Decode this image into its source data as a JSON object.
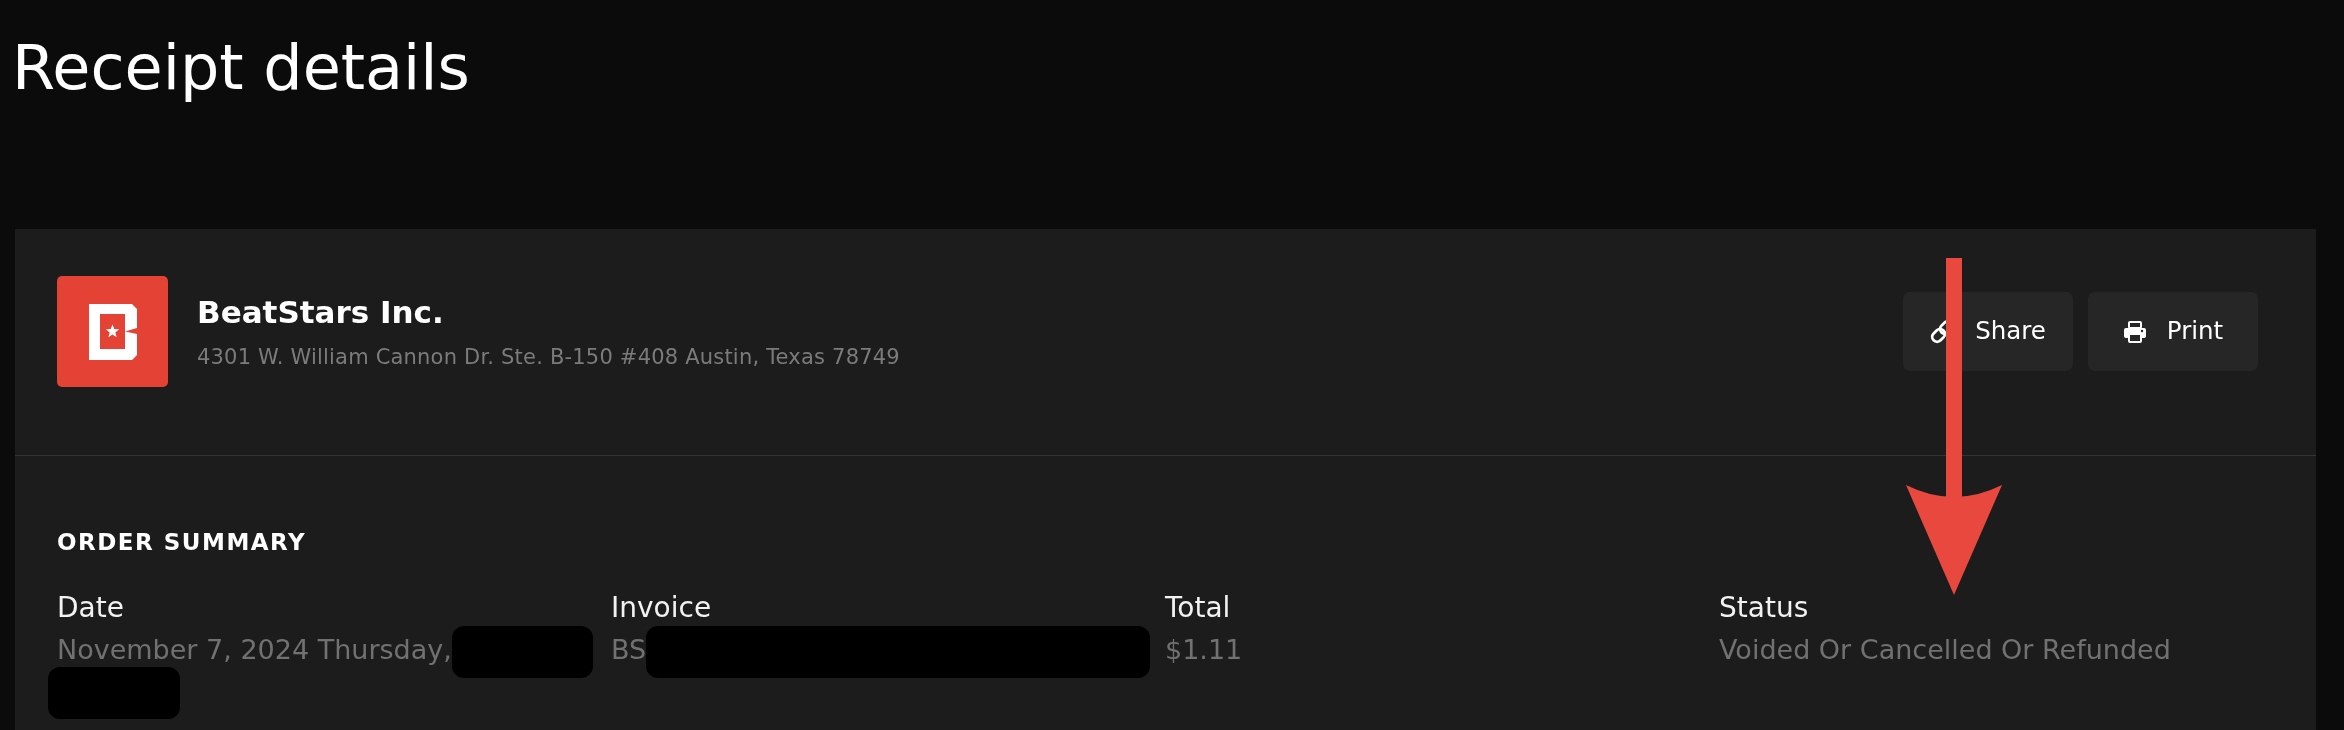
{
  "page": {
    "title": "Receipt details"
  },
  "merchant": {
    "name": "BeatStars Inc.",
    "address": "4301 W. William Cannon Dr. Ste. B-150 #408 Austin, Texas 78749"
  },
  "actions": [
    {
      "kind": "share",
      "label": "Share"
    },
    {
      "kind": "print",
      "label": "Print"
    }
  ],
  "order_summary": {
    "heading": "ORDER SUMMARY",
    "fields": [
      {
        "label": "Date",
        "value": [
          {
            "kind": "text",
            "text": "November 7, 2024 Thursday,"
          },
          {
            "kind": "redacted"
          },
          {
            "kind": "redacted"
          }
        ]
      },
      {
        "label": "Invoice",
        "value": [
          {
            "kind": "text",
            "text": "BS"
          },
          {
            "kind": "redacted"
          }
        ]
      },
      {
        "label": "Total",
        "value": [
          {
            "kind": "text",
            "text": "$1.11"
          }
        ]
      },
      {
        "label": "Status",
        "value": [
          {
            "kind": "text",
            "text": "Voided Or Cancelled Or Refunded"
          }
        ]
      }
    ]
  },
  "annotations": [
    {
      "kind": "arrow"
    }
  ]
}
